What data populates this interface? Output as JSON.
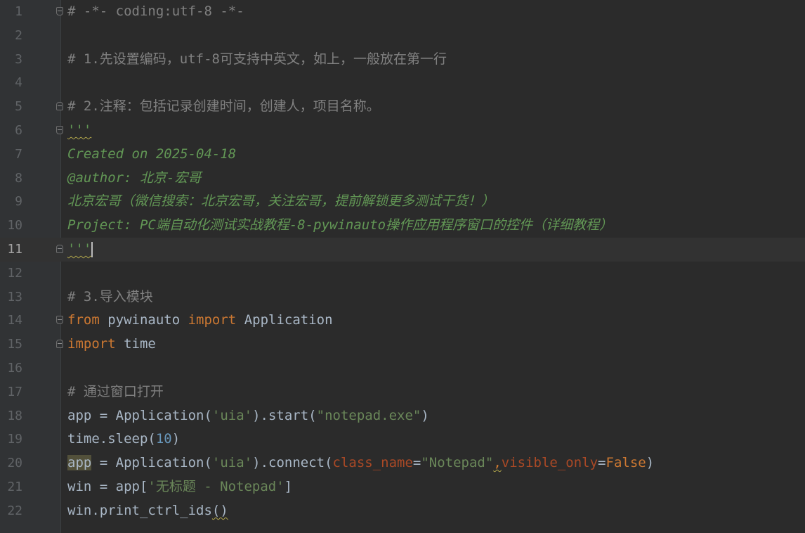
{
  "editor": {
    "theme_colors": {
      "background": "#2b2b2b",
      "gutter": "#313335",
      "comment": "#808080",
      "docstring": "#629755",
      "keyword": "#cc7832",
      "string": "#6a8759",
      "number": "#6897bb",
      "parameter": "#aa4926",
      "default": "#a9b7c6"
    },
    "current_line": 11,
    "lines": [
      {
        "number": "1",
        "tokens": [
          {
            "t": "cm",
            "v": "# -*- coding:utf-8 -*-"
          }
        ]
      },
      {
        "number": "2",
        "tokens": []
      },
      {
        "number": "3",
        "tokens": [
          {
            "t": "cm",
            "v": "# 1.先设置编码，utf-8可支持中英文，如上，一般放在第一行"
          }
        ]
      },
      {
        "number": "4",
        "tokens": []
      },
      {
        "number": "5",
        "tokens": [
          {
            "t": "cm",
            "v": "# 2.注释：包括记录创建时间，创建人，项目名称。"
          }
        ]
      },
      {
        "number": "6",
        "tokens": [
          {
            "t": "doc",
            "v": "'''"
          }
        ]
      },
      {
        "number": "7",
        "tokens": [
          {
            "t": "doc",
            "v": "Created on 2025-04-18"
          }
        ]
      },
      {
        "number": "8",
        "tokens": [
          {
            "t": "doc",
            "v": "@author: 北京-宏哥"
          }
        ]
      },
      {
        "number": "9",
        "tokens": [
          {
            "t": "doc",
            "v": "北京宏哥（微信搜索：北京宏哥，关注宏哥，提前解锁更多测试干货！）"
          }
        ]
      },
      {
        "number": "10",
        "tokens": [
          {
            "t": "doc",
            "v": "Project: PC端自动化测试实战教程-8-pywinauto操作应用程序窗口的控件（详细教程）"
          }
        ]
      },
      {
        "number": "11",
        "tokens": [
          {
            "t": "doc",
            "v": "'''"
          }
        ]
      },
      {
        "number": "12",
        "tokens": []
      },
      {
        "number": "13",
        "tokens": [
          {
            "t": "cm",
            "v": "# 3.导入模块"
          }
        ]
      },
      {
        "number": "14",
        "tokens": [
          {
            "t": "kw",
            "v": "from"
          },
          {
            "t": "plain",
            "v": " pywinauto "
          },
          {
            "t": "kw",
            "v": "import"
          },
          {
            "t": "plain",
            "v": " Application"
          }
        ]
      },
      {
        "number": "15",
        "tokens": [
          {
            "t": "kw",
            "v": "import"
          },
          {
            "t": "plain",
            "v": " time"
          }
        ]
      },
      {
        "number": "16",
        "tokens": []
      },
      {
        "number": "17",
        "tokens": [
          {
            "t": "cm",
            "v": "# 通过窗口打开"
          }
        ]
      },
      {
        "number": "18",
        "tokens": [
          {
            "t": "plain",
            "v": "app = Application("
          },
          {
            "t": "str",
            "v": "'uia'"
          },
          {
            "t": "plain",
            "v": ").start("
          },
          {
            "t": "str",
            "v": "\"notepad.exe\""
          },
          {
            "t": "plain",
            "v": ")"
          }
        ]
      },
      {
        "number": "19",
        "tokens": [
          {
            "t": "plain",
            "v": "time.sleep("
          },
          {
            "t": "num",
            "v": "10"
          },
          {
            "t": "plain",
            "v": ")"
          }
        ]
      },
      {
        "number": "20",
        "tokens": [
          {
            "t": "hl",
            "v": "app"
          },
          {
            "t": "plain",
            "v": " = Application("
          },
          {
            "t": "str",
            "v": "'uia'"
          },
          {
            "t": "plain",
            "v": ").connect("
          },
          {
            "t": "param",
            "v": "class_name"
          },
          {
            "t": "plain",
            "v": "="
          },
          {
            "t": "str",
            "v": "\"Notepad\""
          },
          {
            "t": "kw",
            "v": ","
          },
          {
            "t": "param",
            "v": "visible_only"
          },
          {
            "t": "plain",
            "v": "="
          },
          {
            "t": "kw",
            "v": "False"
          },
          {
            "t": "plain",
            "v": ")"
          }
        ]
      },
      {
        "number": "21",
        "tokens": [
          {
            "t": "plain",
            "v": "win = app["
          },
          {
            "t": "str",
            "v": "'无标题 - Notepad'"
          },
          {
            "t": "plain",
            "v": "]"
          }
        ]
      },
      {
        "number": "22",
        "tokens": [
          {
            "t": "plain",
            "v": "win.print_ctrl_ids()"
          }
        ]
      }
    ]
  }
}
